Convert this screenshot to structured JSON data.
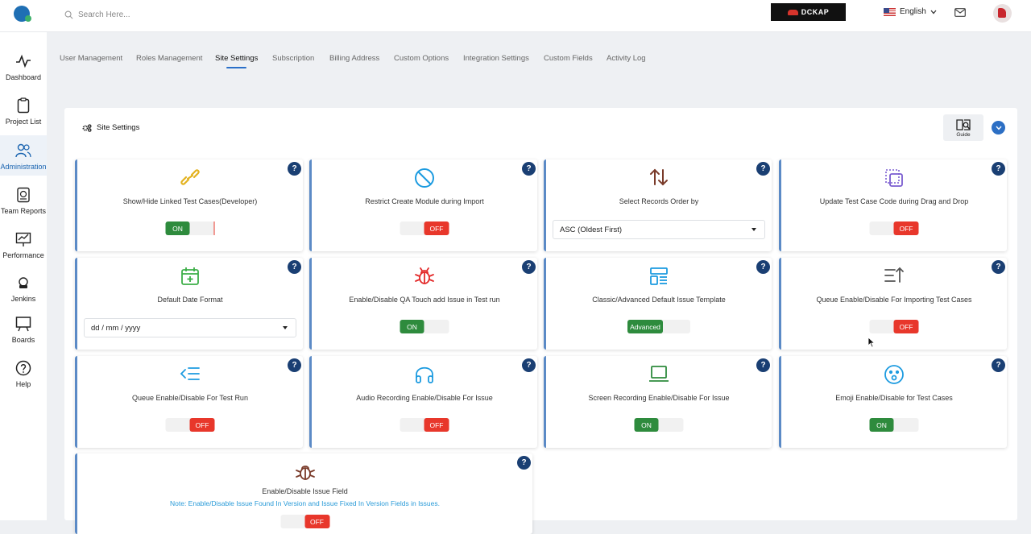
{
  "header": {
    "search_placeholder": "Search Here...",
    "brand": "DCKAP",
    "language": "English"
  },
  "sidebar": {
    "items": [
      {
        "label": "Dashboard",
        "icon": "activity-icon"
      },
      {
        "label": "Project List",
        "icon": "clipboard-icon"
      },
      {
        "label": "Administration",
        "icon": "users-icon",
        "active": true
      },
      {
        "label": "Team Reports",
        "icon": "report-icon"
      },
      {
        "label": "Performance",
        "icon": "chart-icon"
      },
      {
        "label": "Jenkins",
        "icon": "jenkins-icon"
      },
      {
        "label": "Boards",
        "icon": "board-icon"
      },
      {
        "label": "Help",
        "icon": "help-icon"
      }
    ]
  },
  "tabs": [
    "User Management",
    "Roles Management",
    "Site Settings",
    "Subscription",
    "Billing Address",
    "Custom Options",
    "Integration Settings",
    "Custom Fields",
    "Activity Log"
  ],
  "active_tab": "Site Settings",
  "panel": {
    "title": "Site Settings",
    "guide_label": "Guide"
  },
  "cards": [
    {
      "label": "Show/Hide Linked Test Cases(Developer)",
      "icon": "link-icon",
      "state": "ON"
    },
    {
      "label": "Restrict Create Module during Import",
      "icon": "block-icon",
      "state": "OFF"
    },
    {
      "label": "Select Records Order by",
      "icon": "sort-icon",
      "select_value": "ASC (Oldest First)"
    },
    {
      "label": "Update Test Case Code during Drag and Drop",
      "icon": "drag-icon",
      "state": "OFF"
    },
    {
      "label": "Default Date Format",
      "icon": "calendar-icon",
      "select_value": "dd / mm / yyyy"
    },
    {
      "label": "Enable/Disable QA Touch add Issue in Test run",
      "icon": "bug-icon",
      "state": "ON"
    },
    {
      "label": "Classic/Advanced Default Issue Template",
      "icon": "template-icon",
      "state": "Advanced"
    },
    {
      "label": "Queue Enable/Disable For Importing Test Cases",
      "icon": "queue-import-icon",
      "state": "OFF"
    },
    {
      "label": "Queue Enable/Disable For Test Run",
      "icon": "queue-run-icon",
      "state": "OFF"
    },
    {
      "label": "Audio Recording Enable/Disable For Issue",
      "icon": "headphones-icon",
      "state": "OFF"
    },
    {
      "label": "Screen Recording Enable/Disable For Issue",
      "icon": "monitor-icon",
      "state": "ON"
    },
    {
      "label": "Emoji Enable/Disable for Test Cases",
      "icon": "emoji-icon",
      "state": "ON"
    },
    {
      "label": "Enable/Disable Issue Field",
      "icon": "bug-outline-icon",
      "note": "Note: Enable/Disable Issue Found In Version and Issue Fixed In Version Fields in Issues.",
      "state": "OFF"
    }
  ],
  "colors": {
    "accent": "#2a6fc9",
    "on": "#2e8b3d",
    "off": "#e8372b",
    "help": "#1a3f73"
  }
}
